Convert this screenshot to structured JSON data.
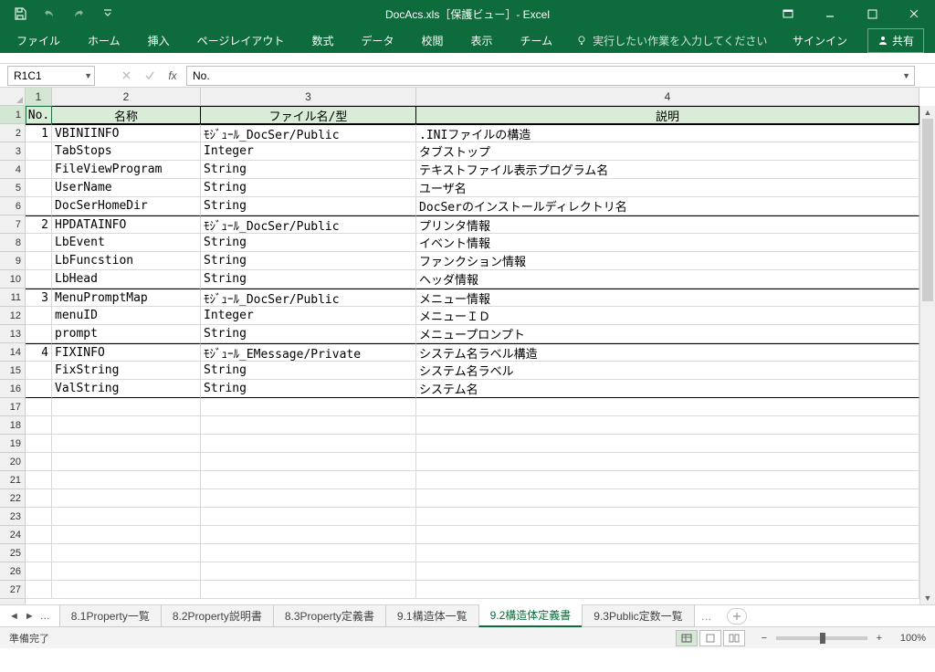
{
  "title": "DocAcs.xls［保護ビュー］- Excel",
  "ribbon": {
    "tabs": [
      "ファイル",
      "ホーム",
      "挿入",
      "ページレイアウト",
      "数式",
      "データ",
      "校閲",
      "表示",
      "チーム"
    ],
    "tell_me": "実行したい作業を入力してください",
    "signin": "サインイン",
    "share": "共有"
  },
  "namebox": "R1C1",
  "formula": "No.",
  "fx": "fx",
  "col_headers": [
    "1",
    "2",
    "3",
    "4"
  ],
  "col_widths": {
    "a": 29,
    "b": 163,
    "c": 236,
    "d": 551
  },
  "row_count": 27,
  "table": {
    "headers": {
      "no": "No.",
      "name": "名称",
      "file": "ファイル名/型",
      "desc": "説明"
    },
    "rows": [
      {
        "no": "1",
        "name": "VBINIINFO",
        "file": "ﾓｼﾞｭｰﾙ_DocSer/Public",
        "desc": ".INIファイルの構造",
        "sep": true
      },
      {
        "no": "",
        "name": "TabStops",
        "file": "Integer",
        "desc": "タブストップ"
      },
      {
        "no": "",
        "name": "FileViewProgram",
        "file": "String",
        "desc": "テキストファイル表示プログラム名"
      },
      {
        "no": "",
        "name": "UserName",
        "file": "String",
        "desc": "ユーザ名"
      },
      {
        "no": "",
        "name": "DocSerHomeDir",
        "file": "String",
        "desc": "DocSerのインストールディレクトリ名"
      },
      {
        "no": "2",
        "name": "HPDATAINFO",
        "file": "ﾓｼﾞｭｰﾙ_DocSer/Public",
        "desc": "プリンタ情報",
        "sep": true
      },
      {
        "no": "",
        "name": "LbEvent",
        "file": "String",
        "desc": "イベント情報"
      },
      {
        "no": "",
        "name": "LbFuncstion",
        "file": "String",
        "desc": "ファンクション情報"
      },
      {
        "no": "",
        "name": "LbHead",
        "file": "String",
        "desc": "ヘッダ情報"
      },
      {
        "no": "3",
        "name": "MenuPromptMap",
        "file": "ﾓｼﾞｭｰﾙ_DocSer/Public",
        "desc": "メニュー情報",
        "sep": true
      },
      {
        "no": "",
        "name": "menuID",
        "file": "Integer",
        "desc": "メニューＩＤ"
      },
      {
        "no": "",
        "name": "prompt",
        "file": "String",
        "desc": "メニュープロンプト"
      },
      {
        "no": "4",
        "name": "FIXINFO",
        "file": "ﾓｼﾞｭｰﾙ_EMessage/Private",
        "desc": "システム名ラベル構造",
        "sep": true
      },
      {
        "no": "",
        "name": "FixString",
        "file": "String",
        "desc": "システム名ラベル"
      },
      {
        "no": "",
        "name": "ValString",
        "file": "String",
        "desc": "システム名",
        "sepbot": true
      }
    ]
  },
  "sheets": {
    "tabs": [
      "8.1Property一覧",
      "8.2Property説明書",
      "8.3Property定義書",
      "9.1構造体一覧",
      "9.2構造体定義書",
      "9.3Public定数一覧"
    ],
    "active": 4,
    "ellipsis": "…"
  },
  "status": {
    "ready": "準備完了",
    "zoom": "100%"
  }
}
